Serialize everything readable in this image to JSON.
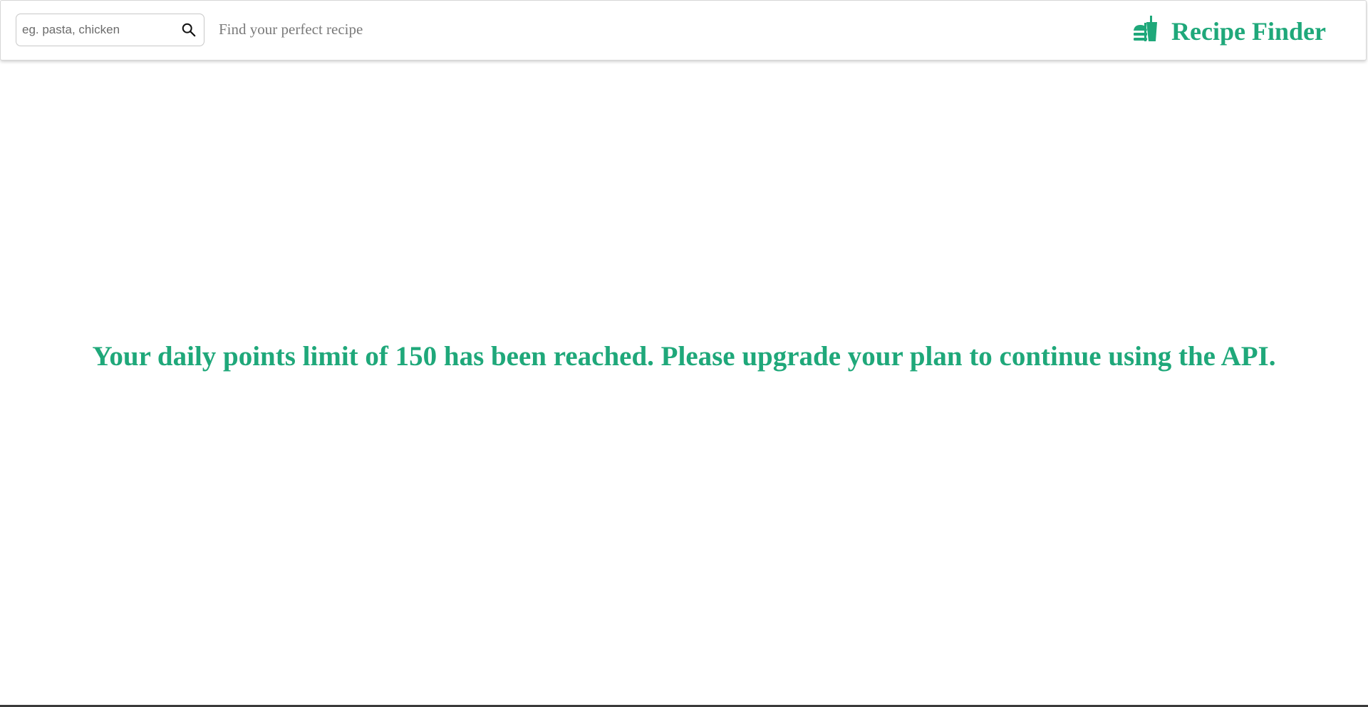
{
  "header": {
    "search": {
      "placeholder": "eg. pasta, chicken",
      "value": ""
    },
    "tagline": "Find your perfect recipe",
    "brand": {
      "title": "Recipe Finder",
      "icon": "fastfood-icon"
    }
  },
  "main": {
    "message": "Your daily points limit of 150 has been reached. Please upgrade your plan to continue using the API."
  },
  "colors": {
    "accent": "#1fa87a",
    "tagline": "#7a7a7a",
    "border": "#c8c8c8"
  }
}
